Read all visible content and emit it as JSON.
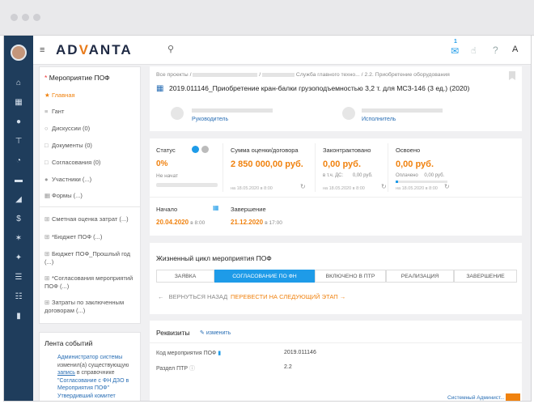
{
  "app": {
    "logo_prefix": "AD",
    "logo_v": "V",
    "logo_suffix": "ANTA",
    "notif_count": "1",
    "user_initial": "A"
  },
  "breadcrumb": {
    "root": "Все проекты",
    "sep": "/",
    "part2": "Служба главного техно...",
    "part3": "2.2. Приобретение оборудования"
  },
  "project_title": "2019.011146_Приобретение кран-балки грузоподъемностью 3,2 т. для МСЗ-146 (3 ед.) (2020)",
  "roles": {
    "manager_label": "Руководитель",
    "executor_label": "Исполнитель"
  },
  "sidebar": {
    "title": "Мероприятие ПОФ",
    "items": [
      {
        "label": "Главная"
      },
      {
        "label": "Гант"
      },
      {
        "label": "Дискуссии (0)"
      },
      {
        "label": "Документы (0)"
      },
      {
        "label": "Согласования (0)"
      },
      {
        "label": "Участники (...)"
      },
      {
        "label": "Формы (...)"
      }
    ],
    "forms": [
      {
        "label": "Сметная оценка затрат (...)"
      },
      {
        "label": "*Бюджет ПОФ (...)"
      },
      {
        "label": "Бюджет ПОФ_Прошлый год (...)"
      },
      {
        "label": "*Согласования мероприятий ПОФ (...)"
      },
      {
        "label": "Затраты по заключенным договорам (...)"
      }
    ]
  },
  "events": {
    "title": "Лента событий",
    "line1": "Администратор системы",
    "line2": "изменил(а) существующую",
    "line3a": "запись",
    "line3b": " в справочнике",
    "line4": "\"Согласование с ФН ДЗО в",
    "line5": "Мероприятия ПОФ\"",
    "line6": "Утвердивший комитет"
  },
  "status": {
    "label": "Статус",
    "value": "0%",
    "sub": "Не начат",
    "sum_label": "Сумма оценки/договора",
    "sum_value": "2 850 000,00 руб.",
    "sum_date": "на 18.05.2020 в 8:00",
    "contracted_label": "Законтрактовано",
    "contracted_value": "0,00 руб.",
    "contracted_sub": "в т.ч. ДС:",
    "contracted_sub_val": "0,00 руб.",
    "contracted_date": "на 18.05.2020 в 8:00",
    "mastered_label": "Освоено",
    "mastered_value": "0,00 руб.",
    "paid_label": "Оплачено",
    "paid_value": "0,00 руб.",
    "mastered_date": "на 18.05.2020 в 8:00",
    "start_label": "Начало",
    "start_date": "20.04.2020",
    "start_time": "в 8:00",
    "end_label": "Завершение",
    "end_date": "21.12.2020",
    "end_time": "в 17:00"
  },
  "lifecycle": {
    "title": "Жизненный цикл мероприятия ПОФ",
    "steps": [
      {
        "label": "ЗАЯВКА"
      },
      {
        "label": "СОГЛАСОВАНИЕ ПО ФН"
      },
      {
        "label": "ВКЛЮЧЕНО В ПТР"
      },
      {
        "label": "РЕАЛИЗАЦИЯ"
      },
      {
        "label": "ЗАВЕРШЕНИЕ"
      }
    ],
    "back_label": "ВЕРНУТЬСЯ НАЗАД",
    "next_label": "ПЕРЕВЕСТИ НА СЛЕДУЮЩИЙ ЭТАП"
  },
  "requisites": {
    "title": "Реквизиты",
    "edit_label": "изменить",
    "rows": [
      {
        "label": "Код мероприятия ПОФ",
        "value": "2019.011146"
      },
      {
        "label": "Раздел ПТР",
        "value": "2.2"
      }
    ],
    "footer_user": "Системный Админист..."
  },
  "colors": {
    "rail": "#1f3d5c",
    "accent": "#f0820f",
    "active_step": "#1e9be8",
    "link": "#2a6fb5"
  }
}
